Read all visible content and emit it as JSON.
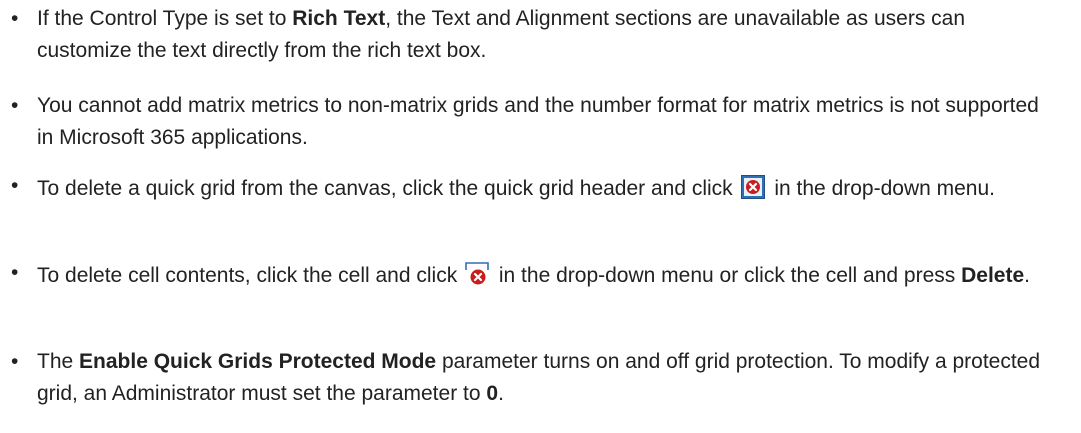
{
  "bullets": {
    "item1": {
      "text1": "If the Control Type is set to ",
      "bold1": "Rich Text",
      "text2": ", the Text and Alignment sections are unavailable as users can customize the text directly from the rich text box."
    },
    "item2": {
      "text1": "You cannot add matrix metrics to non-matrix grids and the number format for matrix metrics is not supported in Microsoft 365 applications."
    },
    "item3": {
      "text1": "To delete a quick grid from the canvas, click the quick grid header and click ",
      "icon": "delete-grid-icon",
      "text2": " in the drop-down menu."
    },
    "item4": {
      "text1": "To delete cell contents, click the cell and click ",
      "icon": "clear-cell-icon",
      "text2": " in the drop-down menu or click the cell and press ",
      "bold1": "Delete",
      "text3": "."
    },
    "item5": {
      "text1": "The ",
      "bold1": "Enable Quick Grids Protected Mode",
      "text2": " parameter turns on and off grid protection. To modify a protected grid, an Administrator must set the parameter to ",
      "bold2": "0",
      "text3": "."
    }
  },
  "colors": {
    "icon_red": "#c81e1e",
    "icon_blue": "#2f6fb5"
  }
}
